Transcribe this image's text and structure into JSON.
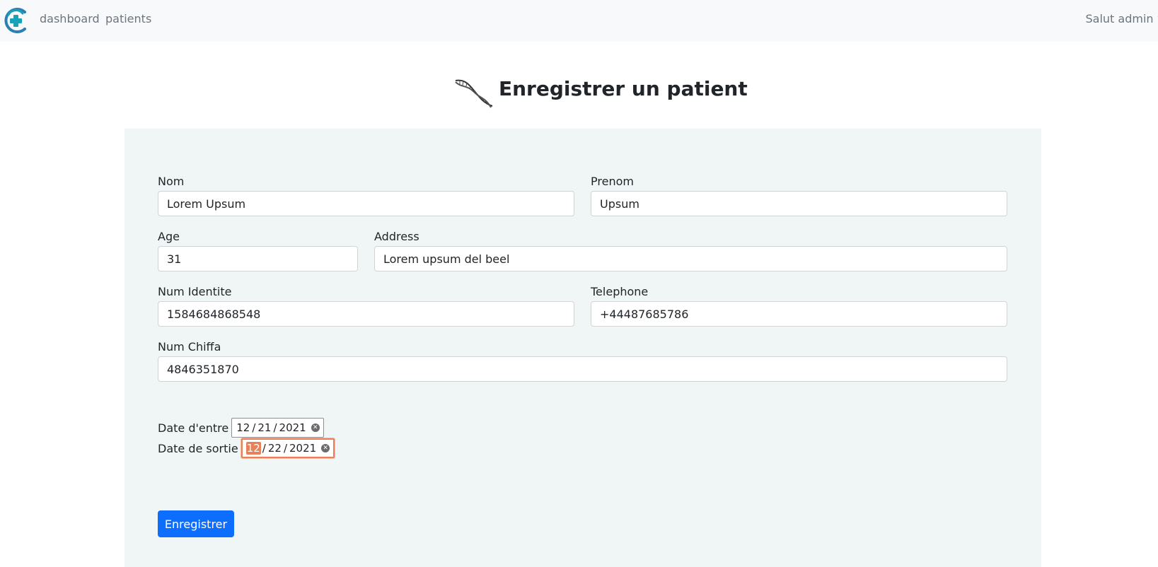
{
  "navbar": {
    "logo_icon": "medical-cross-logo",
    "links": [
      "dashboard",
      "patients"
    ],
    "user_menu": "Salut admin",
    "accent_color": "#17a2b8"
  },
  "header": {
    "icon": "dna-helix-icon",
    "title": "Enregistrer un patient"
  },
  "form": {
    "nom": {
      "label": "Nom",
      "value": "Lorem Upsum"
    },
    "prenom": {
      "label": "Prenom",
      "value": "Upsum"
    },
    "age": {
      "label": "Age",
      "value": "31"
    },
    "address": {
      "label": "Address",
      "value": "Lorem upsum del beel"
    },
    "num_identite": {
      "label": "Num Identite",
      "value": "1584684868548"
    },
    "telephone": {
      "label": "Telephone",
      "value": "+44487685786"
    },
    "num_chiffa": {
      "label": "Num Chiffa",
      "value": "4846351870"
    },
    "date_entre": {
      "label": "Date d'entre",
      "month": "12",
      "day": "21",
      "year": "2021"
    },
    "date_sortie": {
      "label": "Date de sortie",
      "month": "12",
      "day": "22",
      "year": "2021"
    },
    "submit_label": "Enregistrer"
  },
  "colors": {
    "card_bg": "#f0f6f5",
    "primary": "#0d6efd",
    "focus": "#e8815a"
  }
}
